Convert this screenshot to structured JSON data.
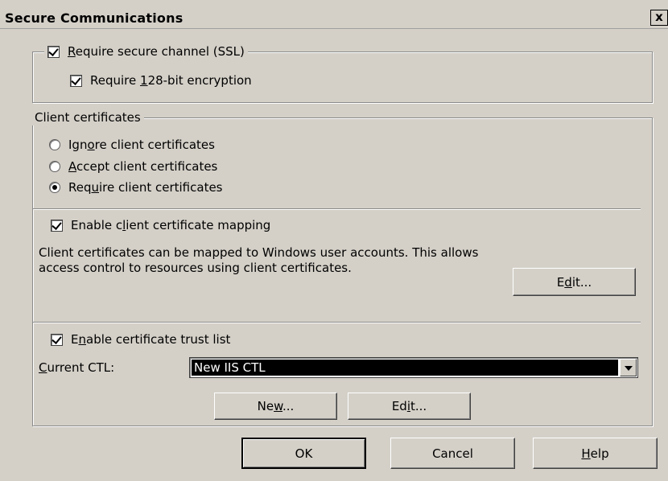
{
  "window": {
    "title": "Secure Communications",
    "close_glyph": "x"
  },
  "ssl": {
    "require_ssl": {
      "pre": "",
      "key": "R",
      "post": "equire secure channel (SSL)",
      "checked": true
    },
    "require_128": {
      "pre": "Require ",
      "key": "1",
      "post": "28-bit encryption",
      "checked": true
    }
  },
  "client_certs": {
    "legend": "Client certificates",
    "ignore": {
      "pre": "Ign",
      "key": "o",
      "post": "re client certificates",
      "selected": false
    },
    "accept": {
      "pre": "",
      "key": "A",
      "post": "ccept client certificates",
      "selected": false
    },
    "require": {
      "pre": "Req",
      "key": "u",
      "post": "ire client certificates",
      "selected": true
    },
    "mapping": {
      "pre": "Enable c",
      "key": "l",
      "post": "ient certificate mapping",
      "checked": true
    },
    "mapping_desc": "Client certificates can be mapped to Windows user accounts.  This allows access control to resources using client certificates.",
    "mapping_edit": {
      "pre": "E",
      "key": "d",
      "post": "it..."
    },
    "ctl_enable": {
      "pre": "E",
      "key": "n",
      "post": "able certificate trust list",
      "checked": true
    },
    "current_ctl_label": {
      "pre": "",
      "key": "C",
      "post": "urrent CTL:"
    },
    "current_ctl_value": "New IIS CTL",
    "new_btn": {
      "pre": "Ne",
      "key": "w",
      "post": "..."
    },
    "ctl_edit_btn": {
      "pre": "Ed",
      "key": "i",
      "post": "t..."
    }
  },
  "footer": {
    "ok": "OK",
    "cancel": "Cancel",
    "help": {
      "pre": "",
      "key": "H",
      "post": "elp"
    }
  }
}
